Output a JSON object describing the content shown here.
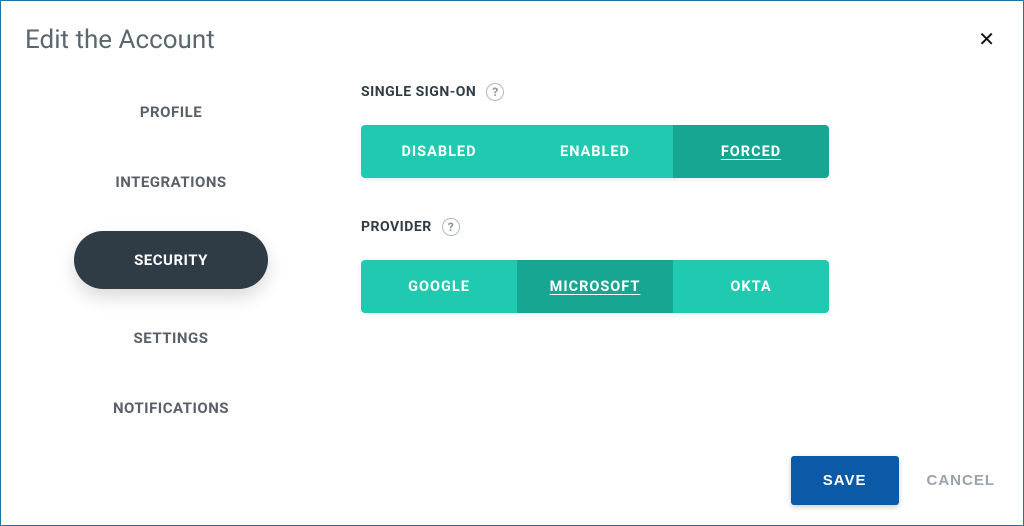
{
  "dialog": {
    "title": "Edit the Account"
  },
  "sidebar": {
    "items": [
      {
        "label": "PROFILE",
        "active": false
      },
      {
        "label": "INTEGRATIONS",
        "active": false
      },
      {
        "label": "SECURITY",
        "active": true
      },
      {
        "label": "SETTINGS",
        "active": false
      },
      {
        "label": "NOTIFICATIONS",
        "active": false
      }
    ]
  },
  "fields": {
    "sso": {
      "label": "SINGLE SIGN-ON",
      "options": [
        "DISABLED",
        "ENABLED",
        "FORCED"
      ],
      "selected": "FORCED"
    },
    "provider": {
      "label": "PROVIDER",
      "options": [
        "GOOGLE",
        "MICROSOFT",
        "OKTA"
      ],
      "selected": "MICROSOFT"
    }
  },
  "footer": {
    "save": "SAVE",
    "cancel": "CANCEL"
  }
}
